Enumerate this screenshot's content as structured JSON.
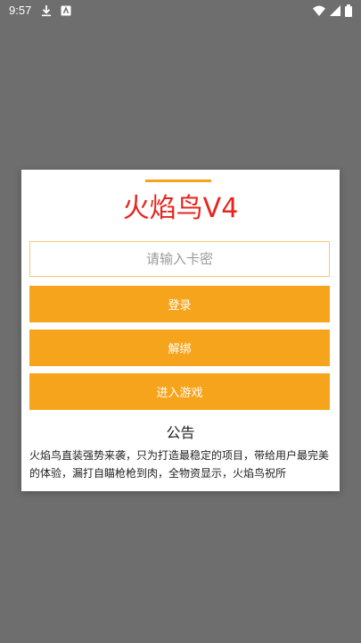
{
  "status_bar": {
    "time": "9:57",
    "left_icons": [
      "download-icon",
      "notification-icon"
    ],
    "right_icons": [
      "wifi-icon",
      "signal-icon",
      "battery-icon"
    ]
  },
  "dialog": {
    "title": "火焰鸟V4",
    "card_input": {
      "placeholder": "请输入卡密",
      "value": ""
    },
    "buttons": {
      "login": "登录",
      "unbind": "解绑",
      "enter_game": "进入游戏"
    },
    "notice": {
      "heading": "公告",
      "body": "火焰鸟直装强势来袭，只为打造最稳定的项目，带给用户最完美的体验，漏打自瞄枪枪到肉，全物资显示，火焰鸟祝所"
    }
  },
  "colors": {
    "accent": "#f7a41d",
    "title": "#e8251d",
    "backdrop": "#6e6e6e",
    "input_border": "#f4c978"
  }
}
